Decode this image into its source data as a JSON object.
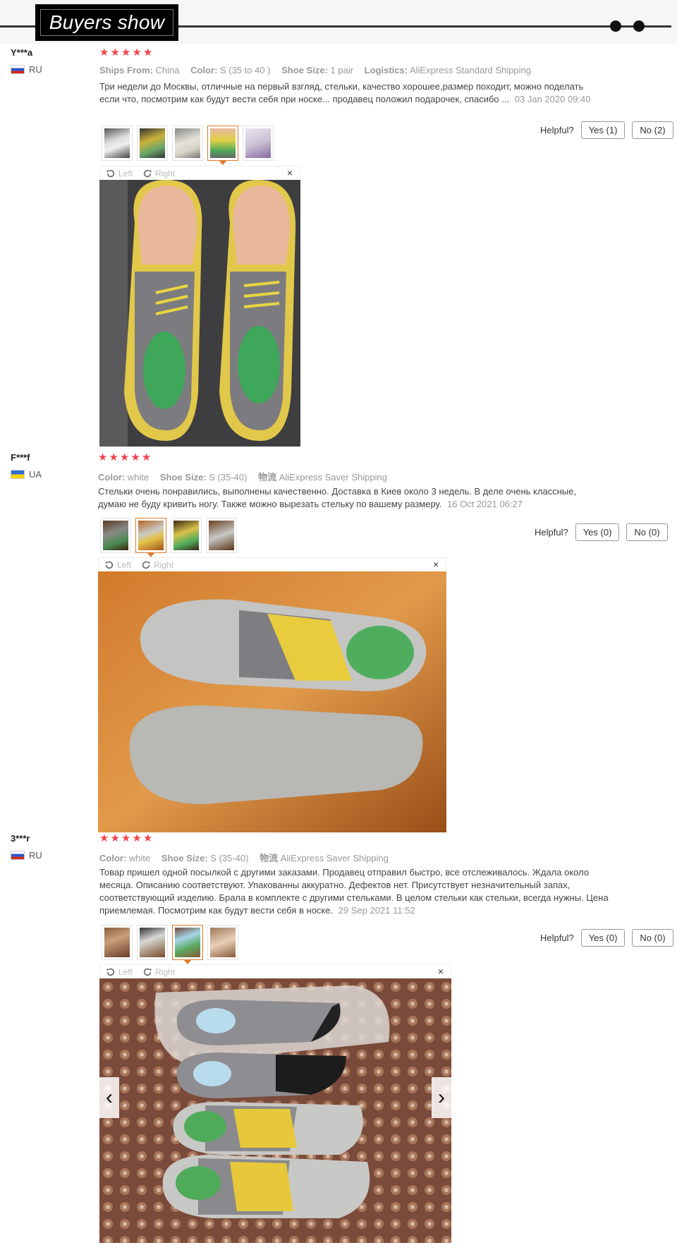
{
  "header": {
    "title": "Buyers show"
  },
  "reviews": [
    {
      "user": "Y***a",
      "country": "RU",
      "flag": "ru",
      "stars": [
        "★",
        "★",
        "★",
        "★",
        "★"
      ],
      "attributes": [
        {
          "key": "Ships From:",
          "value": "China"
        },
        {
          "key": "Color:",
          "value": "S (35 to 40 )"
        },
        {
          "key": "Shoe Size:",
          "value": "1 pair"
        },
        {
          "key": "Logistics:",
          "value": "AliExpress Standard Shipping"
        }
      ],
      "text": "Три недели до Москвы, отличные на первый взгляд, стельки, качество хорошее,размер походит, можно поделать если что, посмотрим как будут вести себя при носке... продавец положил подарочек, спасибо ...",
      "date": "03 Jan 2020 09:40",
      "helpful_label": "Helpful?",
      "yes_label": "Yes (1)",
      "no_label": "No (2)",
      "viewer": {
        "left_label": "Left",
        "right_label": "Right",
        "close": "×"
      }
    },
    {
      "user": "F***f",
      "country": "UA",
      "flag": "ua",
      "stars": [
        "★",
        "★",
        "★",
        "★",
        "★"
      ],
      "attributes": [
        {
          "key": "Color:",
          "value": "white"
        },
        {
          "key": "Shoe Size:",
          "value": "S (35-40)"
        },
        {
          "key": "物流",
          "value": "AliExpress Saver Shipping"
        }
      ],
      "text": "Стельки очень понравились, выполнены качественно. Доставка в Киев около 3 недель. В деле очень классные, думаю не буду кривить ногу. Также можно вырезать стельку по вашему размеру.",
      "date": "16 Oct 2021 06:27",
      "helpful_label": "Helpful?",
      "yes_label": "Yes (0)",
      "no_label": "No (0)",
      "viewer": {
        "left_label": "Left",
        "right_label": "Right",
        "close": "×"
      }
    },
    {
      "user": "3***r",
      "country": "RU",
      "flag": "ru",
      "stars": [
        "★",
        "★",
        "★",
        "★",
        "★"
      ],
      "attributes": [
        {
          "key": "Color:",
          "value": "white"
        },
        {
          "key": "Shoe Size:",
          "value": "S (35-40)"
        },
        {
          "key": "物流",
          "value": "AliExpress Saver Shipping"
        }
      ],
      "text": "Товар пришел одной посылкой с другими заказами. Продавец отправил быстро, все отслеживалось. Ждала около месяца. Описанию соответствуют. Упакованны аккуратно. Дефектов нет. Присутствует незначительный запах, соответствующий изделию. Брала в комплекте с другими стельками. В целом стельки как стельки, всегда нужны. Цена приемлемая. Посмотрим как будут вести себя в носке.",
      "date": "29 Sep 2021 11:52",
      "helpful_label": "Helpful?",
      "yes_label": "Yes (0)",
      "no_label": "No (0)",
      "viewer": {
        "left_label": "Left",
        "right_label": "Right",
        "close": "×",
        "prev": "‹",
        "next": "›"
      }
    }
  ]
}
